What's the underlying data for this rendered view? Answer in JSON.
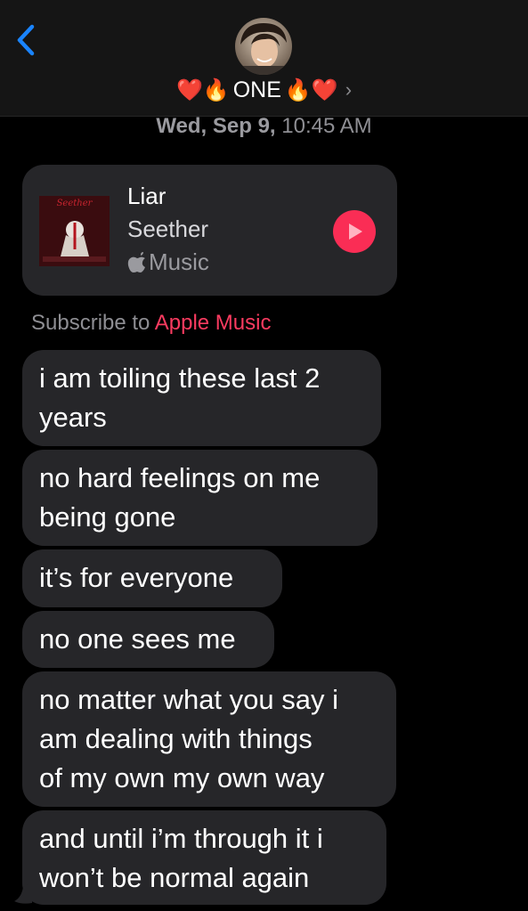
{
  "header": {
    "contact_name": "ONE",
    "contact_prefix": "❤️🔥",
    "contact_suffix": "🔥❤️",
    "details_chevron": "›",
    "icons": [
      "chevron-left-icon",
      "avatar",
      "chevron-right-icon"
    ]
  },
  "timestamp": {
    "day": "Wed, Sep 9,",
    "time": " 10:45 AM"
  },
  "music_card": {
    "title": "Liar",
    "artist": "Seether",
    "service": "Music",
    "album_band_text": "Seether",
    "accent_color": "#fa2d55"
  },
  "subscribe": {
    "prefix": "Subscribe to ",
    "link": "Apple Music"
  },
  "messages": [
    "i am toiling these last 2\nyears",
    "no hard feelings on me\nbeing gone",
    "it’s for everyone",
    "no one sees me",
    "no matter what you say i\nam dealing with things\nof my own my own way",
    "and until i’m through it i\nwon’t be normal again"
  ],
  "colors": {
    "background": "#000000",
    "header": "#151515",
    "bubble": "#262629",
    "back_blue": "#1a84ff",
    "link_pink": "#fb3b60"
  }
}
